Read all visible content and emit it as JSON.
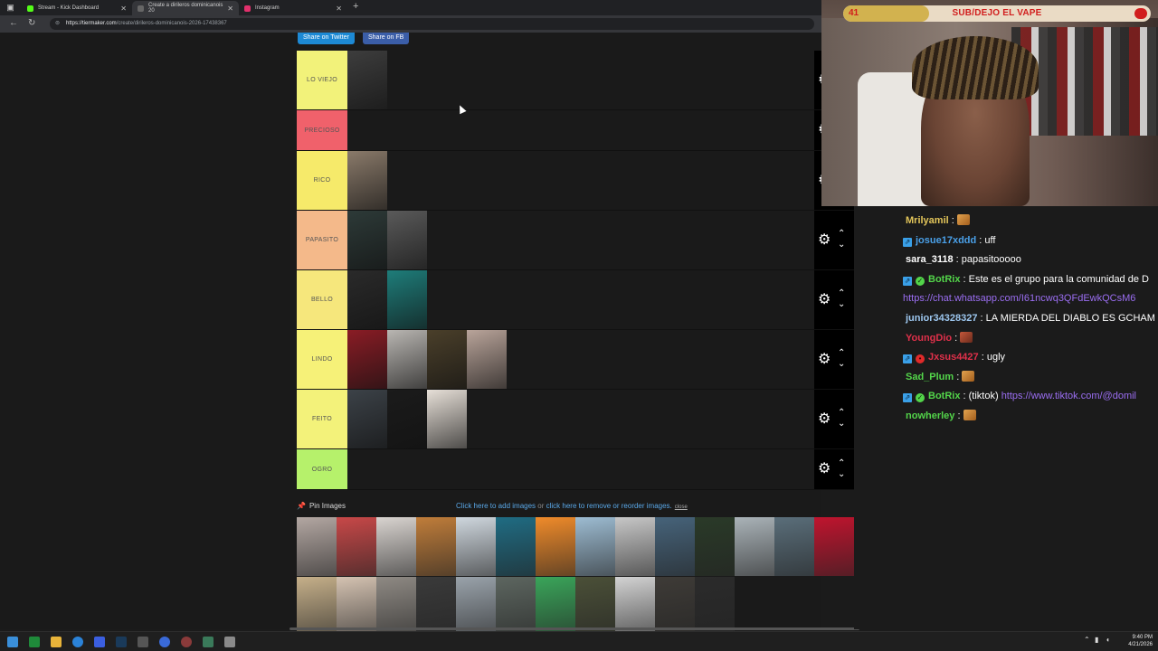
{
  "browser": {
    "tabs": [
      {
        "title": "Stream - Kick Dashboard",
        "favicon_color": "#53fc18"
      },
      {
        "title": "Create a dirileros dominicanois 20",
        "favicon_color": "#666666"
      },
      {
        "title": "Instagram",
        "favicon_color": "#e1306c"
      }
    ],
    "url_host": "https://tiermaker.com",
    "url_path": "/create/dirileros-dominicanois-2026-17438367"
  },
  "share": {
    "twitter": "Share on Twitter",
    "fb": "Share on FB"
  },
  "tiers": [
    {
      "label": "LO VIEJO",
      "color": "#f2f27a",
      "items": [
        "#3d3d3d"
      ]
    },
    {
      "label": "PRECIOSO",
      "color": "#f0616b",
      "items": []
    },
    {
      "label": "RICO",
      "color": "#f6ea6a",
      "items": [
        "#8a7a6a"
      ]
    },
    {
      "label": "PAPASITO",
      "color": "#f4b98a",
      "items": [
        "#2d3a38",
        "#5a5a5a"
      ]
    },
    {
      "label": "BELLO",
      "color": "#f6e77c",
      "items": [
        "#2a2a2a",
        "#1e7d7a"
      ]
    },
    {
      "label": "LINDO",
      "color": "#f6f178",
      "items": [
        "#8a1c25",
        "#b9b6b2",
        "#4a3f2a",
        "#b9a49a"
      ]
    },
    {
      "label": "FEITO",
      "color": "#f3f27a",
      "items": [
        "#3c4248",
        "#1b1b1b",
        "#e7e0d8"
      ]
    },
    {
      "label": "OGRO",
      "color": "#b6f16b",
      "items": []
    }
  ],
  "pin": {
    "label": "Pin Images",
    "link_add": "Click here to add images",
    "or": " or ",
    "link_remove": "click here to remove or reorder images.",
    "close": "close"
  },
  "pool": [
    [
      "#b3a7a2",
      "#c84848",
      "#d9d4d0",
      "#c07d3a",
      "#cfd7de",
      "#1f6c83",
      "#f08b2a",
      "#9dbcd2",
      "#c7c7c7",
      "#46637a",
      "#2a3a28",
      "#aab3b8",
      "#5a6e7a",
      "#c0142e"
    ],
    [
      "#c6b08a",
      "#d5c3b2",
      "#8f8a84",
      "#3a3a3a",
      "#9aa3ab",
      "#5d6660",
      "#3aa55a",
      "#4b5038",
      "#d3d3d3",
      "#3e3b37",
      "#2b2b2b"
    ]
  ],
  "stream": {
    "goal_count": "41",
    "goal_text": "SUB/DEJO EL VAPE",
    "goal_progress": 0.28,
    "chat": [
      {
        "badges": [],
        "user": "Mrilyamil",
        "user_color": "#e2c55a",
        "text": "",
        "emote": "w"
      },
      {
        "badges": [
          "mod"
        ],
        "user": "josue17xddd",
        "user_color": "#4aa0e8",
        "text": "uff",
        "emote": ""
      },
      {
        "badges": [],
        "user": "sara_3118",
        "user_color": "#ffffff",
        "text": "papasitooooo",
        "emote": ""
      },
      {
        "badges": [
          "mod",
          "verified"
        ],
        "user": "BotRix",
        "user_color": "#53d54a",
        "text": "Este es el grupo para la comunidad de D",
        "emote": ""
      },
      {
        "badges": [],
        "user": "",
        "user_color": "#ffffff",
        "text": "",
        "link": "https://chat.whatsapp.com/I61ncwq3QFdEwkQCsM6",
        "emote": ""
      },
      {
        "badges": [],
        "user": "junior34328327",
        "user_color": "#9dc7ef",
        "text": "LA MIERDA DEL DIABLO ES GCHAM",
        "emote": ""
      },
      {
        "badges": [],
        "user": "YoungDio",
        "user_color": "#e0304a",
        "text": "",
        "emote": "pic"
      },
      {
        "badges": [
          "mod",
          "red"
        ],
        "user": "Jxsus4427",
        "user_color": "#e0304a",
        "text": "ugly",
        "emote": ""
      },
      {
        "badges": [],
        "user": "Sad_Plum",
        "user_color": "#53d54a",
        "text": "",
        "emote": "w"
      },
      {
        "badges": [
          "mod",
          "verified"
        ],
        "user": "BotRix",
        "user_color": "#53d54a",
        "text": "(tiktok)",
        "link": "https://www.tiktok.com/@domil",
        "emote": ""
      },
      {
        "badges": [],
        "user": "nowherley",
        "user_color": "#53d54a",
        "text": "",
        "emote": "w"
      }
    ]
  },
  "taskbar": {
    "time": "9:40 PM",
    "date": "4/21/2026"
  },
  "colors": {
    "accent": "#1d89d4",
    "page_bg": "#1a1a1a",
    "control_bg": "#000000"
  }
}
